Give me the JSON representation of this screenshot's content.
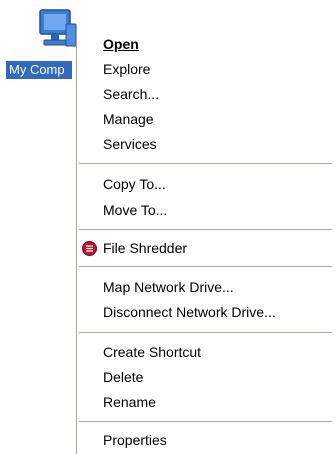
{
  "desktop": {
    "icon_label": "My Comp"
  },
  "menu": {
    "open": "Open",
    "explore": "Explore",
    "search": "Search...",
    "manage": "Manage",
    "services": "Services",
    "copy_to": "Copy To...",
    "move_to": "Move To...",
    "file_shredder": "File Shredder",
    "map_network_drive": "Map Network Drive...",
    "disconnect_network_drive": "Disconnect Network Drive...",
    "create_shortcut": "Create Shortcut",
    "delete": "Delete",
    "rename": "Rename",
    "properties": "Properties"
  },
  "icons": {
    "desktop_icon": "computer-monitor-icon",
    "shredder_icon": "file-shredder-icon"
  },
  "colors": {
    "selection": "#316ac5",
    "separator": "#aca899",
    "shredder": "#c8102e"
  }
}
